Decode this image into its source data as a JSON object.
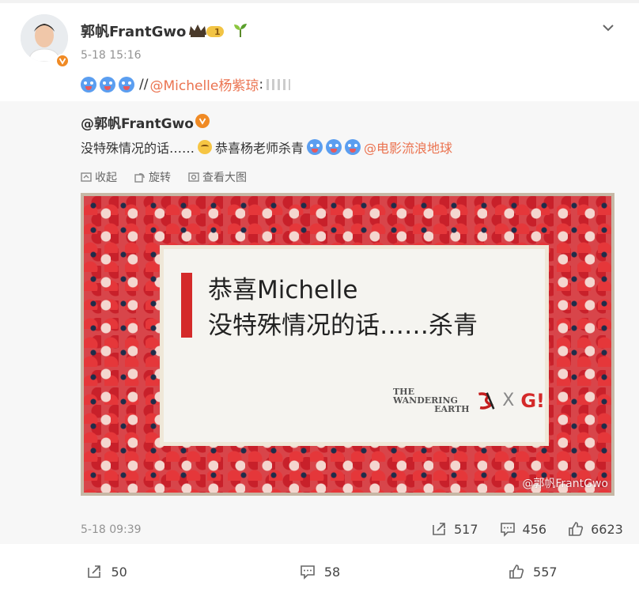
{
  "post": {
    "author": "郭帆FrantGwo",
    "level": "1",
    "time": "5-18 15:16",
    "emoji_name": "doge-blue-tongue",
    "content_separator": "//",
    "mention": "@Michelle杨紫琼",
    "mention_colon": ":"
  },
  "repost": {
    "author": "@郭帆FrantGwo",
    "text_before": "没特殊情况的话……",
    "text_middle": "恭喜杨老师杀青",
    "mention": "@电影流浪地球",
    "actions": [
      {
        "label": "收起",
        "icon": "collapse-icon"
      },
      {
        "label": "旋转",
        "icon": "rotate-icon"
      },
      {
        "label": "查看大图",
        "icon": "view-large-icon"
      }
    ],
    "image": {
      "line1": "恭喜Michelle",
      "line2": "没特殊情况的话……杀青",
      "logo_text_a": "THE WANDERING",
      "logo_text_b": "EARTH",
      "logo_x": "X",
      "logo_gi": "G!",
      "watermark": "@郭帆FrantGwo"
    },
    "time": "5-18 09:39",
    "stats": {
      "reposts": "517",
      "comments": "456",
      "likes": "6623"
    }
  },
  "footer": {
    "reposts": "50",
    "comments": "58",
    "likes": "557"
  },
  "colors": {
    "accent": "#eb7350",
    "verified": "#f08a24",
    "emoji": "#5b9ef0"
  }
}
